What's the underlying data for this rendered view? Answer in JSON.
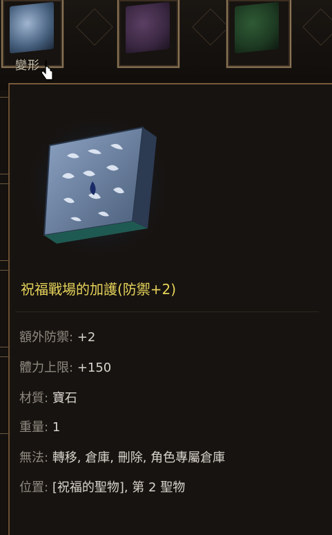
{
  "inventory": {
    "slots": [
      {
        "icon": "blue-crest-gem-icon",
        "label": "變形"
      },
      {
        "icon": "purple-crest-gem-icon"
      },
      {
        "icon": "green-crest-gem-icon"
      }
    ]
  },
  "tooltip": {
    "item_icon": "blessed-battlefield-tablet-icon",
    "title": "祝福戰場的加護(防禦+2)",
    "title_color": "#e6d35a",
    "attributes": [
      {
        "key": "額外防禦:",
        "value": "+2"
      },
      {
        "key": "體力上限:",
        "value": "+150"
      },
      {
        "key": "材質:",
        "value": "寶石"
      },
      {
        "key": "重量:",
        "value": "1"
      },
      {
        "key": "無法:",
        "value": "轉移, 倉庫, 刪除, 角色專屬倉庫"
      },
      {
        "key": "位置:",
        "value": "[祝福的聖物], 第 2 聖物"
      }
    ]
  }
}
